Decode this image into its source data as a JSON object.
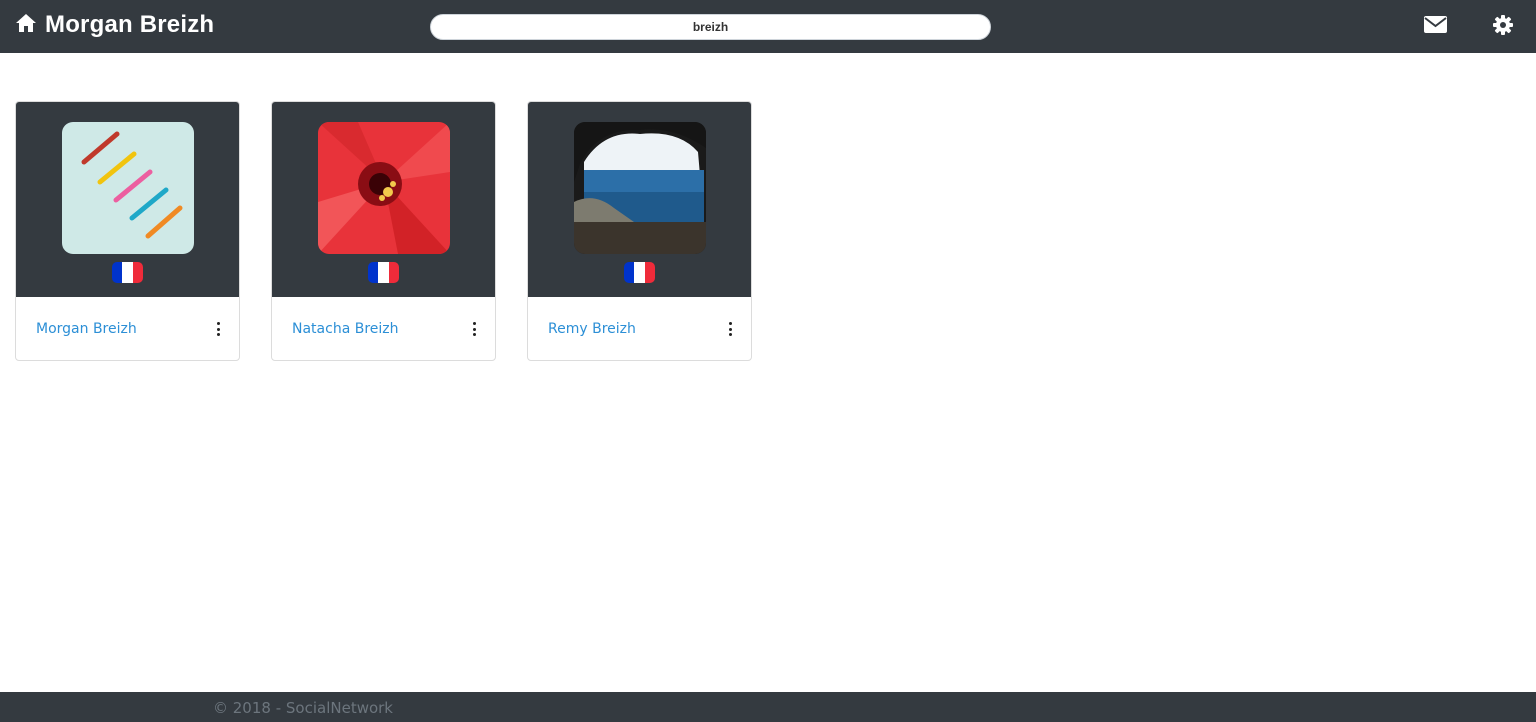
{
  "header": {
    "title": "Morgan Breizh",
    "home_icon": "home-icon",
    "search": {
      "value": "breizh",
      "placeholder": ""
    },
    "icons": [
      "envelope-icon",
      "gear-icon"
    ]
  },
  "results": [
    {
      "name": "Morgan Breizh",
      "avatar": "colored-pencils-photo",
      "flag": "france-flag"
    },
    {
      "name": "Natacha Breizh",
      "avatar": "red-hibiscus-photo",
      "flag": "france-flag"
    },
    {
      "name": "Remy Breizh",
      "avatar": "sea-cave-photo",
      "flag": "france-flag"
    }
  ],
  "footer": {
    "text": "© 2018 - SocialNetwork"
  },
  "colors": {
    "navbar": "#343a40",
    "link": "#2c8fd6",
    "footer_text": "#6c757d",
    "flag_blue": "#0033cc",
    "flag_white": "#ffffff",
    "flag_red": "#ef2b3a"
  }
}
